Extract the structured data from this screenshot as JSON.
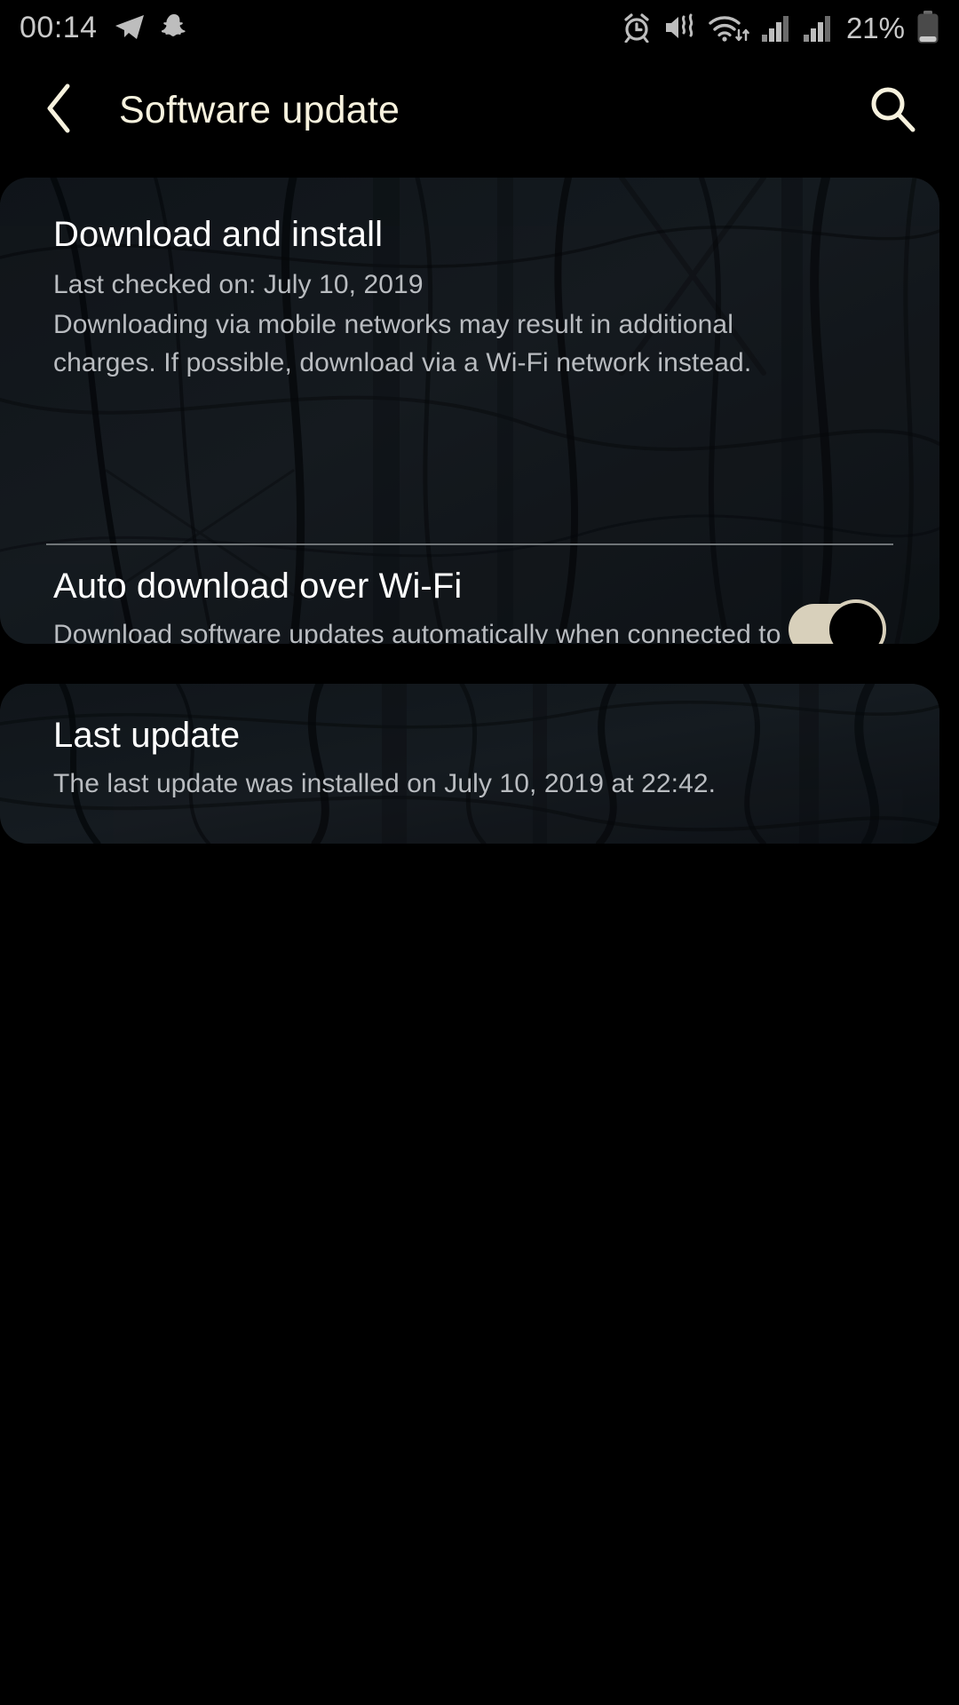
{
  "status_bar": {
    "time": "00:14",
    "battery_percent": "21%",
    "left_icons": [
      "telegram-icon",
      "snapchat-icon"
    ],
    "right_icons": [
      "alarm-icon",
      "mute-vibrate-icon",
      "wifi-icon",
      "signal-bars-sim1-icon",
      "signal-bars-sim2-icon",
      "battery-icon"
    ],
    "text_color": "#c9c9c9"
  },
  "app_bar": {
    "back_label": "back-arrow",
    "title": "Software update",
    "search_label": "search",
    "accent_color": "#f7f2de"
  },
  "cards": {
    "download_and_install": {
      "title": "Download and install",
      "last_checked": "Last checked on: July 10, 2019",
      "description": "Downloading via mobile networks may result in additional charges. If possible, download via a Wi-Fi network instead."
    },
    "auto_download": {
      "title": "Auto download over Wi-Fi",
      "description": "Download software updates automatically when connected to a Wi-Fi network.",
      "toggle_state": "on",
      "toggle_track_color": "#d8d0bb",
      "toggle_knob_color": "#000000"
    },
    "last_update": {
      "title": "Last update",
      "description": "The last update was installed on July 10, 2019 at 22:42."
    }
  },
  "theme": {
    "background": "#000000",
    "card_background": "#12161a",
    "primary_text": "#ffffff",
    "secondary_text": "#b9bcc0",
    "divider": "#6f7477"
  }
}
